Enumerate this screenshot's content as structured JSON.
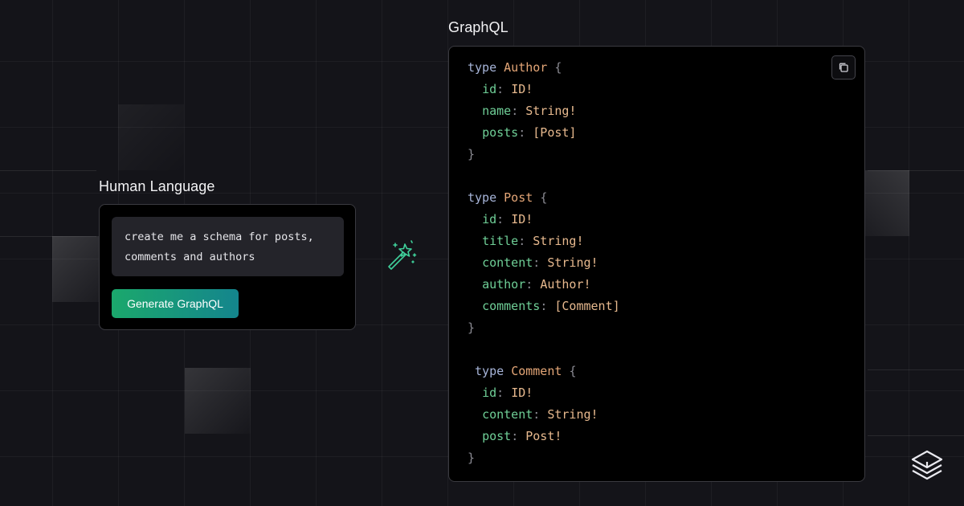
{
  "human_panel": {
    "label": "Human Language",
    "prompt_text": "create me a schema for posts,\ncomments and authors",
    "generate_button_label": "Generate GraphQL"
  },
  "graphql_panel": {
    "label": "GraphQL",
    "copy_icon": "copy-icon",
    "code_lines": [
      {
        "kw": "type",
        "name": "Author",
        "open": "{"
      },
      {
        "field": "id",
        "colon": ":",
        "ftype": "ID!"
      },
      {
        "field": "name",
        "colon": ":",
        "ftype": "String!"
      },
      {
        "field": "posts",
        "colon": ":",
        "ftype": "[Post]"
      },
      {
        "close": "}"
      },
      {},
      {
        "kw": "type",
        "name": "Post",
        "open": "{"
      },
      {
        "field": "id",
        "colon": ":",
        "ftype": "ID!"
      },
      {
        "field": "title",
        "colon": ":",
        "ftype": "String!"
      },
      {
        "field": "content",
        "colon": ":",
        "ftype": "String!"
      },
      {
        "field": "author",
        "colon": ":",
        "ftype": "Author!"
      },
      {
        "field": "comments",
        "colon": ":",
        "ftype": "[Comment]"
      },
      {
        "close": "}"
      },
      {},
      {
        "kw": "type",
        "name": "Comment",
        "open": "{",
        "lead": " "
      },
      {
        "field": "id",
        "colon": ":",
        "ftype": "ID!"
      },
      {
        "field": "content",
        "colon": ":",
        "ftype": "String!"
      },
      {
        "field": "post",
        "colon": ":",
        "ftype": "Post!"
      },
      {
        "close": "}"
      }
    ]
  },
  "icons": {
    "wand": "magic-wand-icon",
    "brand": "stacked-layers-logo-icon"
  },
  "colors": {
    "background": "#141419",
    "card": "#000000",
    "accent_start": "#1ba86c",
    "accent_end": "#14858d",
    "keyword": "#a6b4d8",
    "type_name": "#e4a677",
    "field": "#6fcf97"
  }
}
